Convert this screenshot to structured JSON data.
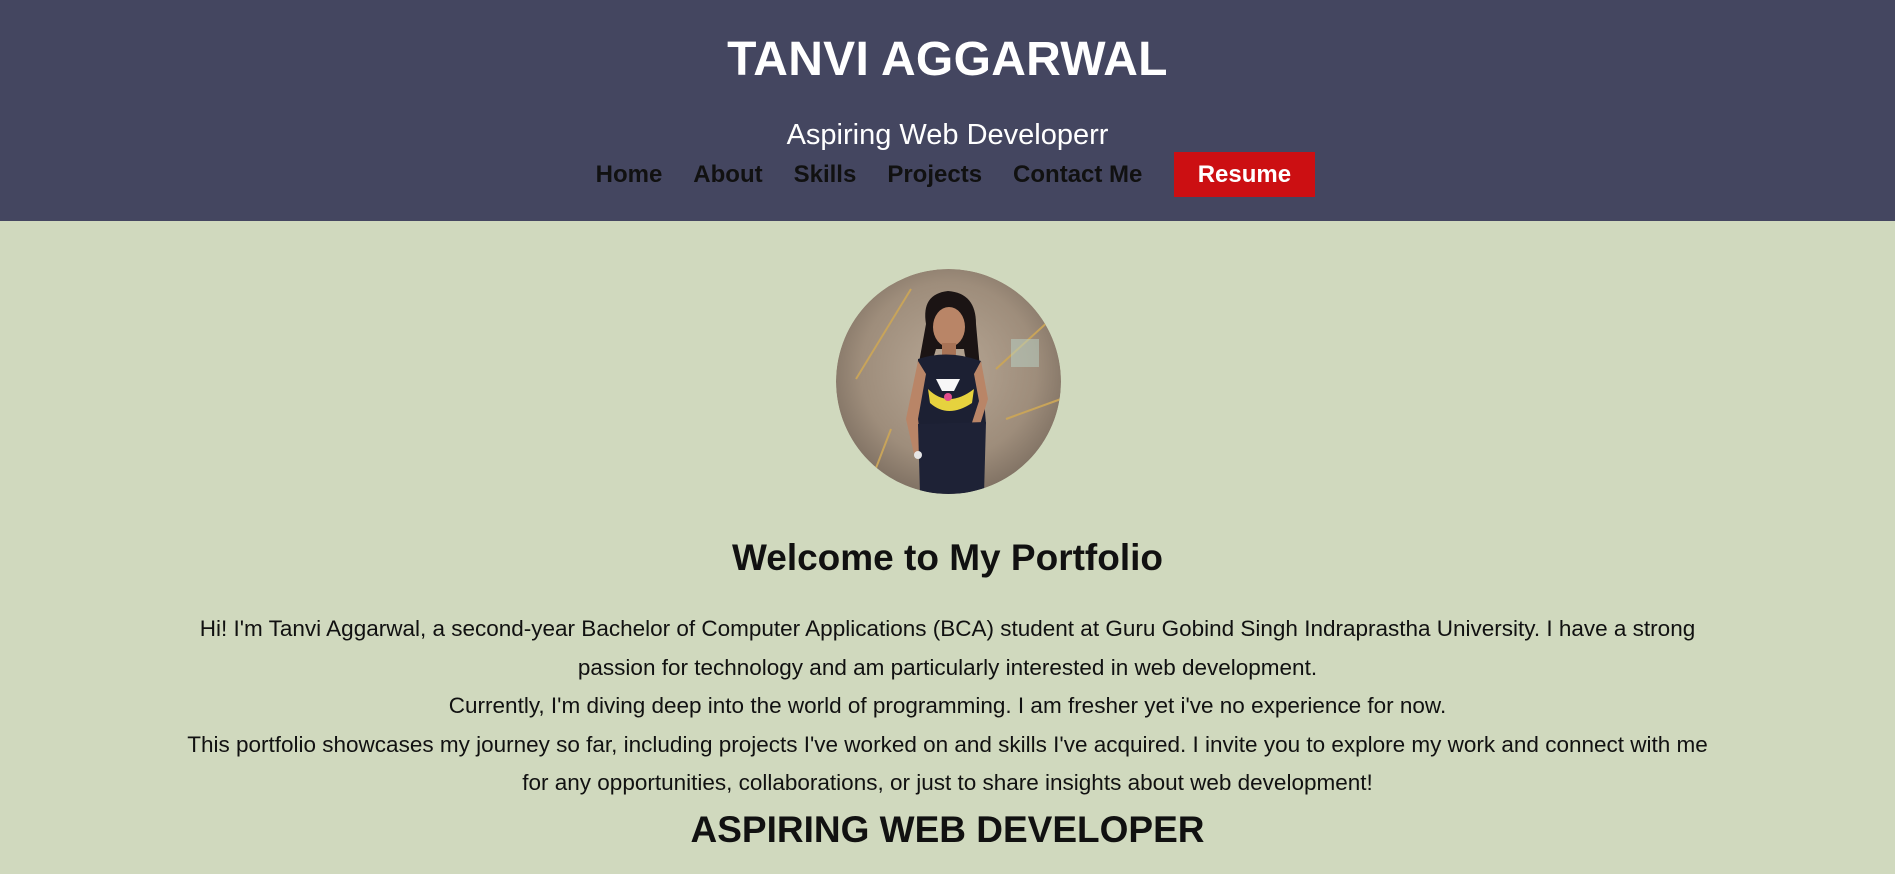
{
  "header": {
    "title": "TANVI AGGARWAL",
    "tagline": "Aspiring Web Developerr"
  },
  "nav": {
    "items": [
      {
        "label": "Home"
      },
      {
        "label": "About"
      },
      {
        "label": "Skills"
      },
      {
        "label": "Projects"
      },
      {
        "label": "Contact Me"
      }
    ],
    "resume_label": "Resume"
  },
  "main": {
    "welcome_heading": "Welcome to My Portfolio",
    "intro_lines": [
      "Hi! I'm Tanvi Aggarwal, a second-year Bachelor of Computer Applications (BCA) student at Guru Gobind Singh Indraprastha University. I have a strong passion for technology and am particularly interested in web development.",
      "Currently, I'm diving deep into the world of programming. I am fresher yet i've no experience for now.",
      "This portfolio showcases my journey so far, including projects I've worked on and skills I've acquired. I invite you to explore my work and connect with me for any opportunities, collaborations, or just to share insights about web development!"
    ],
    "role_heading": "ASPIRING WEB DEVELOPER"
  },
  "colors": {
    "header_bg": "#444660",
    "page_bg": "#d0d9be",
    "resume_bg": "#cc0f12",
    "text_dark": "#111111",
    "text_light": "#ffffff"
  },
  "icons": {
    "avatar": "profile-photo"
  }
}
